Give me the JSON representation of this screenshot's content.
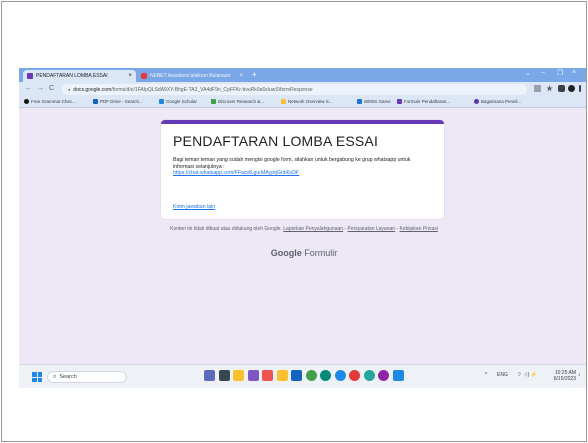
{
  "browser": {
    "tabs": [
      {
        "title": "PENDAFTARAN LOMBA ESSAI",
        "close": "×",
        "icon": "google-forms-icon",
        "color": "#673ab7"
      },
      {
        "title": "NEBET Assalamu'alaikum Bulanaan",
        "close": "×",
        "icon": "youtube-icon",
        "color": "#e53935"
      }
    ],
    "new_tab": "+",
    "window_controls": {
      "minimize": "⌄",
      "restore": "–",
      "maximize": "❐",
      "close": "×"
    },
    "nav": {
      "back": "←",
      "forward": "→",
      "reload": "C"
    },
    "address": {
      "lock": "🔒",
      "host": "docs.google.com",
      "path": "/forms/d/e/1FAIpQLSdA9XY-BhgE-TA3_VA4dF9ri_CpFFKr-bvuRk0a6xIuwS/formResponse"
    },
    "bookmarks": [
      {
        "label": "Free Grammar Chec...",
        "color": "#111111"
      },
      {
        "label": "PDF Drive - Search...",
        "color": "#1565c0"
      },
      {
        "label": "Google Scholar",
        "color": "#1e88e5"
      },
      {
        "label": "Discover Research &...",
        "color": "#43a047"
      },
      {
        "label": "Network Overview S...",
        "color": "#fbc02d"
      },
      {
        "label": "WEBS Game",
        "color": "#1976d2"
      },
      {
        "label": "Formulir Pendaftaran...",
        "color": "#673ab7"
      },
      {
        "label": "Bagaimana Peneli...",
        "color": "#5e35b1"
      }
    ]
  },
  "form": {
    "title": "PENDAFTARAN LOMBA ESSAI",
    "description": "Bagi teman teman yang sudah mengisi google form, silahkan untuk bergabung ke grup whatsapp untuk informasi selanjutnya :",
    "link": "https://chat.whatsapp.com/FFacv8.gurMAypqGnb6vDF",
    "submit_again": "Kirim jawaban lain",
    "disclaimer_text": "Konten ini tidak dibuat atau didukung oleh Google.",
    "report_link": "Laporkan Penyalahgunaan",
    "terms_link": "Persyaratan Layanan",
    "privacy_link": "Kebijakan Privasi",
    "branding": {
      "google": "Google",
      "forms": "Formulir"
    }
  },
  "taskbar": {
    "search_label": "Search",
    "apps": [
      {
        "icon": "task-view-icon",
        "color": "#5c6bc0"
      },
      {
        "icon": "widgets-icon",
        "color": "#37474f"
      },
      {
        "icon": "weather-icon",
        "color": "#fbc02d"
      },
      {
        "icon": "chat-icon",
        "color": "#7e57c2"
      },
      {
        "icon": "settings-icon",
        "color": "#ef5350"
      },
      {
        "icon": "file-explorer-icon",
        "color": "#fbc02d"
      },
      {
        "icon": "store-icon",
        "color": "#1565c0"
      },
      {
        "icon": "chrome-icon",
        "color": "#43a047"
      },
      {
        "icon": "chrome-profile-icon",
        "color": "#00897b"
      },
      {
        "icon": "chrome-profile-2-icon",
        "color": "#1e88e5"
      },
      {
        "icon": "chrome-profile-3-icon",
        "color": "#e53935"
      },
      {
        "icon": "edge-icon",
        "color": "#26a69a"
      },
      {
        "icon": "chrome-profile-4-icon",
        "color": "#8e24aa"
      },
      {
        "icon": "photos-icon",
        "color": "#1e88e5"
      }
    ],
    "tray": {
      "chevron": "^",
      "lang": "ENG",
      "status": "⌔ ◁) ⚡"
    },
    "clock": {
      "time": "10:25 AM",
      "date": "6/15/2023"
    },
    "notify": "♪"
  }
}
